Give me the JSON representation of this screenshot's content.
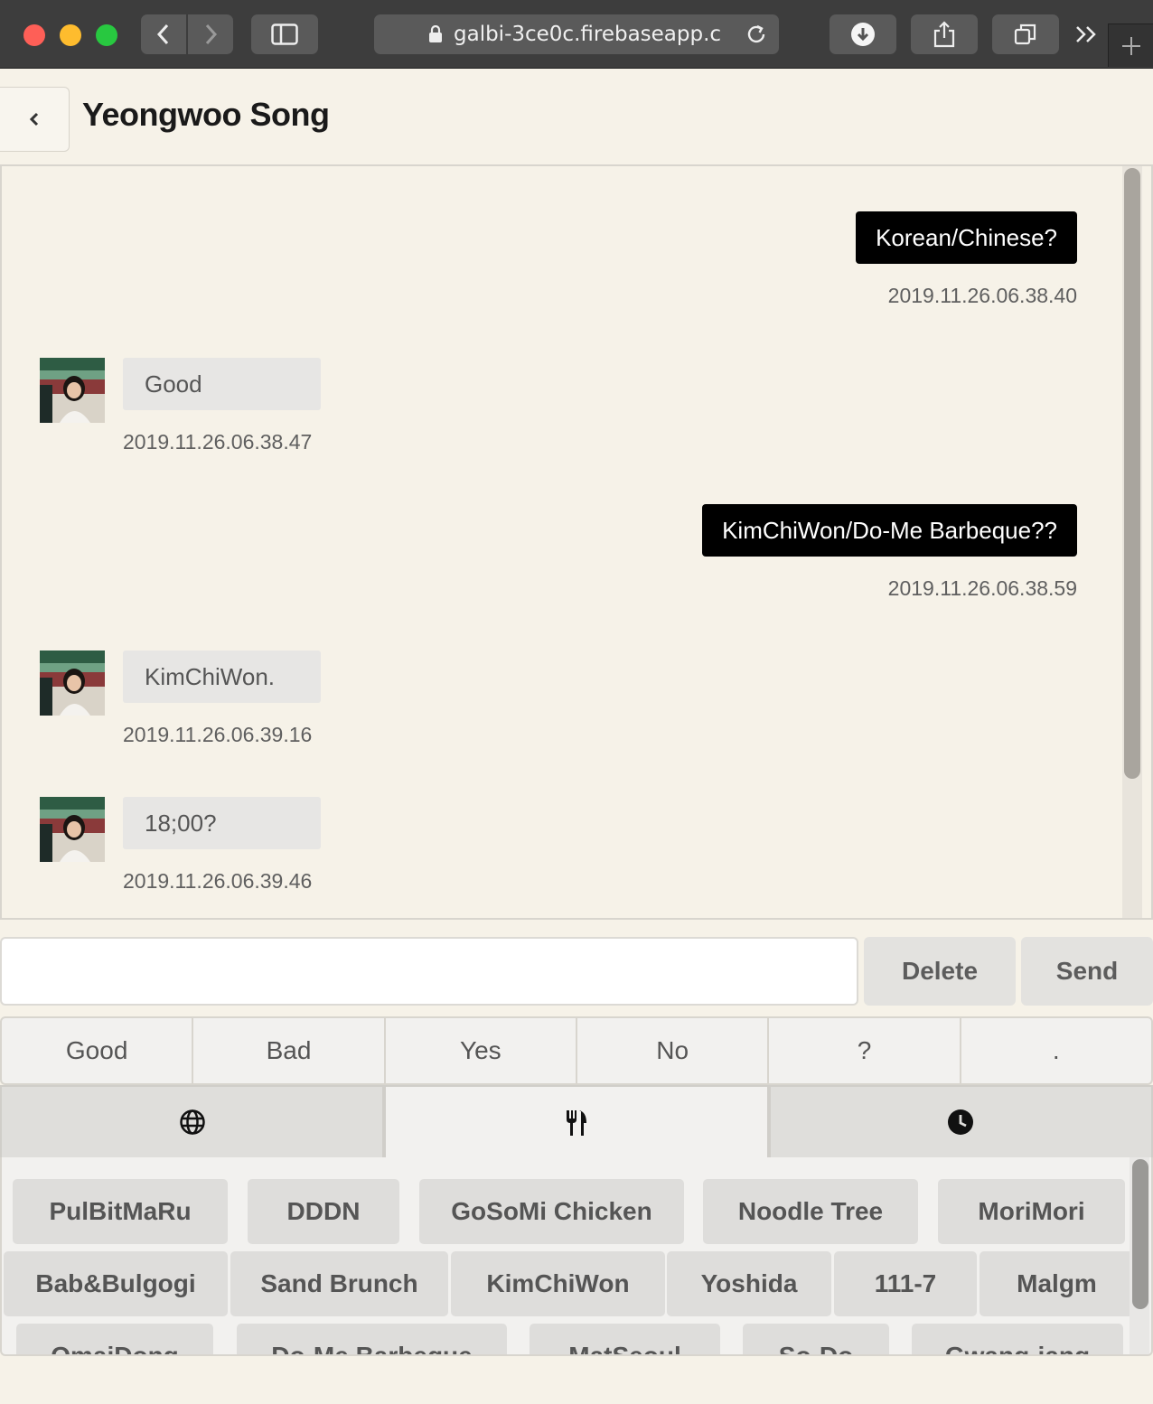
{
  "browser": {
    "url": "galbi-3ce0c.firebaseapp.c"
  },
  "header": {
    "title": "Yeongwoo Song"
  },
  "messages": [
    {
      "dir": "out",
      "text": "Korean/Chinese?",
      "time": "2019.11.26.06.38.40"
    },
    {
      "dir": "in",
      "text": "Good",
      "time": "2019.11.26.06.38.47"
    },
    {
      "dir": "out",
      "text": "KimChiWon/Do-Me Barbeque??",
      "time": "2019.11.26.06.38.59"
    },
    {
      "dir": "in",
      "text": "KimChiWon.",
      "time": "2019.11.26.06.39.16"
    },
    {
      "dir": "in",
      "text": "18;00?",
      "time": "2019.11.26.06.39.46"
    }
  ],
  "composer": {
    "value": "",
    "placeholder": "",
    "delete_label": "Delete",
    "send_label": "Send"
  },
  "quick_replies": [
    "Good",
    "Bad",
    "Yes",
    "No",
    "?",
    "."
  ],
  "tabs": [
    {
      "icon": "globe-icon",
      "active": false
    },
    {
      "icon": "utensils-icon",
      "active": true
    },
    {
      "icon": "clock-icon",
      "active": false
    }
  ],
  "restaurants": [
    [
      "PulBitMaRu",
      "DDDN",
      "GoSoMi Chicken",
      "Noodle Tree",
      "MoriMori"
    ],
    [
      "Bab&Bulgogi",
      "Sand Brunch",
      "KimChiWon",
      "Yoshida",
      "111-7",
      "Malgm"
    ],
    [
      "OmaiDong",
      "Do-Me Barbeque",
      "MatSeoul",
      "So-Do",
      "Gwang-jang"
    ]
  ],
  "colors": {
    "background": "#f6f2e8",
    "outgoing_bubble": "#000000",
    "incoming_bubble": "#e7e6e4",
    "button": "#dedddb"
  }
}
